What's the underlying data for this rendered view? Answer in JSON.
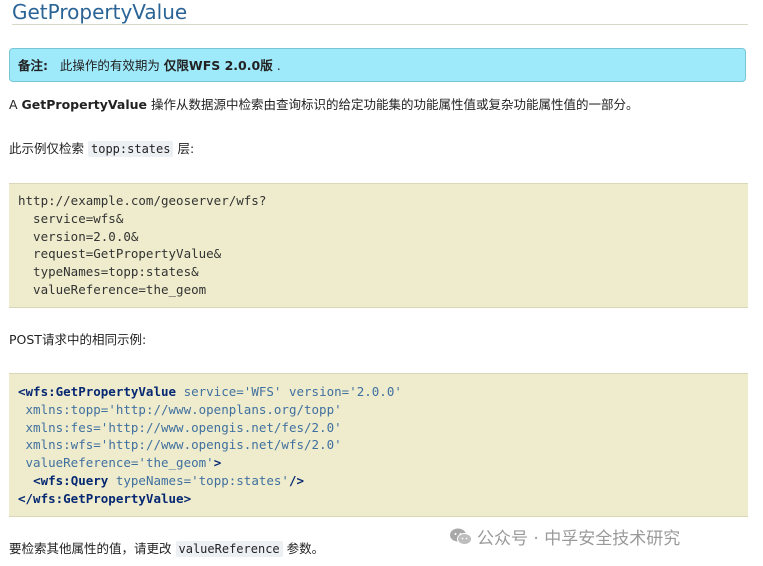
{
  "title": "GetPropertyValue",
  "note": {
    "label": "备注:",
    "text_before": "此操作的有效期为",
    "emphasis": "仅限WFS 2.0.0版",
    "text_after": "."
  },
  "intro": {
    "prefix": "A",
    "op": "GetPropertyValue",
    "text": "操作从数据源中检索由查询标识的给定功能集的功能属性值或复杂功能属性值的一部分。"
  },
  "example_intro": {
    "before": "此示例仅检索",
    "code": "topp:states",
    "after": "层:"
  },
  "get_request": {
    "lines": [
      "http://example.com/geoserver/wfs?",
      "  service=wfs&",
      "  version=2.0.0&",
      "  request=GetPropertyValue&",
      "  typeNames=topp:states&",
      "  valueReference=the_geom"
    ]
  },
  "post_intro": "POST请求中的相同示例:",
  "post_request": {
    "root_open": "<wfs:GetPropertyValue",
    "service_attr": "service=",
    "service_val": "'WFS'",
    "version_attr": "version=",
    "version_val": "'2.0.0'",
    "ns_topp_attr": "xmlns:topp=",
    "ns_topp_val": "'http://www.openplans.org/topp'",
    "ns_fes_attr": "xmlns:fes=",
    "ns_fes_val": "'http://www.opengis.net/fes/2.0'",
    "ns_wfs_attr": "xmlns:wfs=",
    "ns_wfs_val": "'http://www.opengis.net/wfs/2.0'",
    "valref_attr": "valueReference=",
    "valref_val": "'the_geom'",
    "gt": ">",
    "query_open": "<wfs:Query",
    "typenames_attr": "typeNames=",
    "typenames_val": "'topp:states'",
    "query_close": "/>",
    "root_close": "</wfs:GetPropertyValue>"
  },
  "footer": {
    "before": "要检索其他属性的值，请更改",
    "code": "valueReference",
    "after": "参数。"
  },
  "watermark": {
    "icon": "wechat-icon",
    "text": "公众号 · 中孚安全技术研究"
  }
}
